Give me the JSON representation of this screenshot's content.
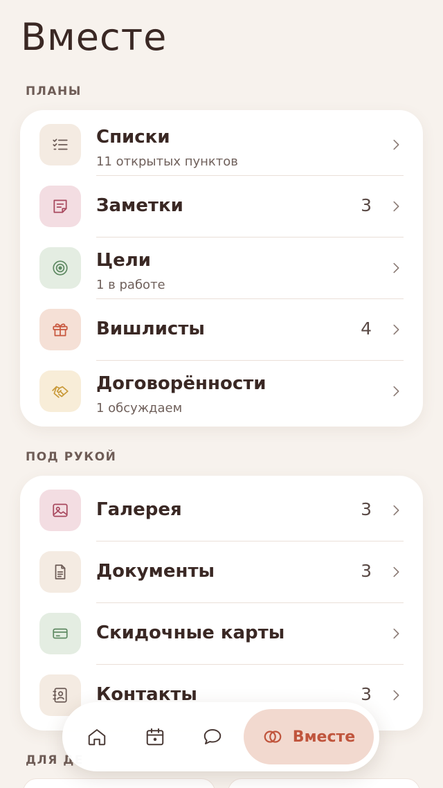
{
  "header": {
    "title": "Вместе"
  },
  "sections": {
    "plans": {
      "label": "ПЛАНЫ",
      "items": [
        {
          "title": "Списки",
          "subtitle": "11 открытых пунктов",
          "count": "",
          "icon": "checklist-icon"
        },
        {
          "title": "Заметки",
          "subtitle": "",
          "count": "3",
          "icon": "note-icon"
        },
        {
          "title": "Цели",
          "subtitle": "1 в работе",
          "count": "",
          "icon": "target-icon"
        },
        {
          "title": "Вишлисты",
          "subtitle": "",
          "count": "4",
          "icon": "gift-icon"
        },
        {
          "title": "Договорённости",
          "subtitle": "1 обсуждаем",
          "count": "",
          "icon": "handshake-icon"
        }
      ]
    },
    "at_hand": {
      "label": "ПОД РУКОЙ",
      "items": [
        {
          "title": "Галерея",
          "subtitle": "",
          "count": "3",
          "icon": "image-icon"
        },
        {
          "title": "Документы",
          "subtitle": "",
          "count": "3",
          "icon": "document-icon"
        },
        {
          "title": "Скидочные карты",
          "subtitle": "",
          "count": "",
          "icon": "card-icon"
        },
        {
          "title": "Контакты",
          "subtitle": "",
          "count": "3",
          "icon": "contacts-icon"
        }
      ]
    },
    "next": {
      "label": "ДЛЯ ДЕ"
    }
  },
  "tabbar": {
    "items": [
      {
        "name": "home",
        "icon": "home-icon"
      },
      {
        "name": "calendar",
        "icon": "calendar-icon"
      },
      {
        "name": "chat",
        "icon": "chat-icon"
      }
    ],
    "active_label": "Вместе",
    "active_icon": "rings-icon"
  },
  "colors": {
    "background": "#f7f2ed",
    "accent": "#c0553d",
    "accent_bg": "#f2d9cf"
  }
}
